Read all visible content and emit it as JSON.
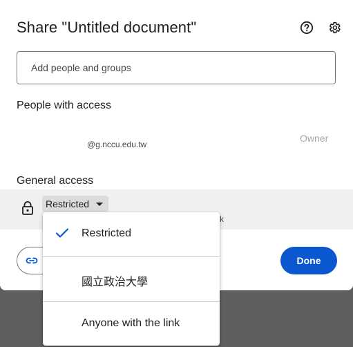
{
  "dialog": {
    "title": "Share \"Untitled document\"",
    "help_icon": "help-circle-icon",
    "settings_icon": "gear-icon"
  },
  "add_people": {
    "placeholder": "Add people and groups"
  },
  "people_with_access": {
    "label": "People with access",
    "people": [
      {
        "email": "@g.nccu.edu.tw",
        "role": "Owner"
      }
    ]
  },
  "general_access": {
    "label": "General access",
    "selected": "Restricted",
    "description_fragment": "k"
  },
  "footer": {
    "copy_link_icon": "link-icon",
    "done_label": "Done"
  },
  "access_menu": {
    "items": [
      {
        "label": "Restricted",
        "checked": true
      },
      {
        "label": "國立政治大學",
        "checked": false
      },
      {
        "label": "Anyone with the link",
        "checked": false
      }
    ]
  },
  "colors": {
    "accent": "#0b57d0",
    "backdrop": "#5f5f5f",
    "selected_row": "#f0f0f0"
  }
}
